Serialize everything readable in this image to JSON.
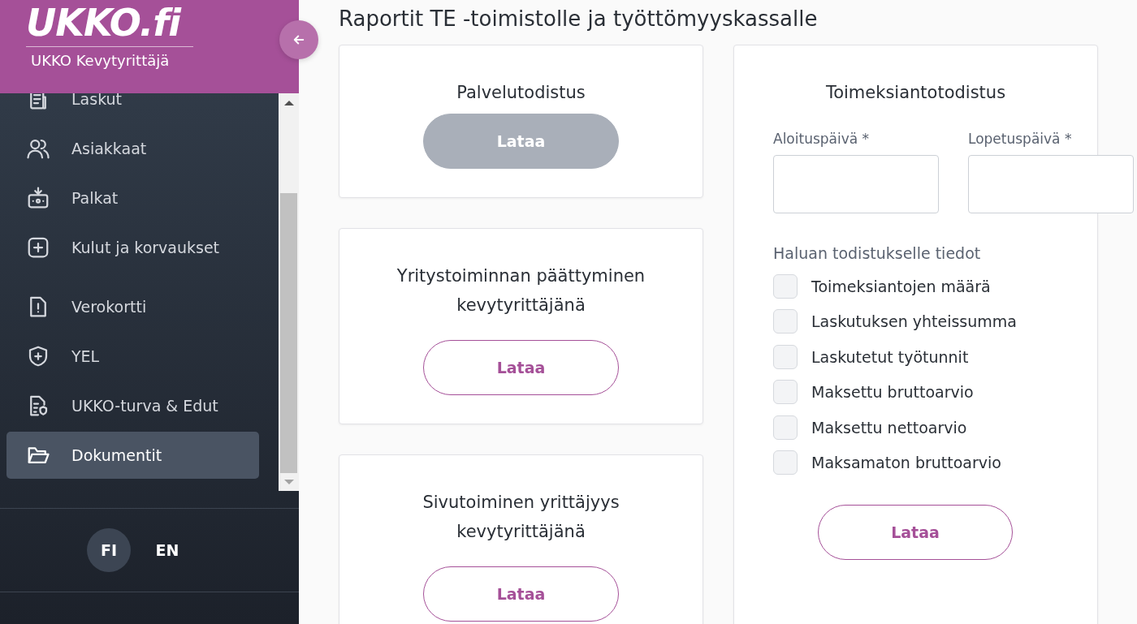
{
  "sidebar": {
    "logo": "UKKO.fi",
    "subtitle": "UKKO Kevytyrittäjä",
    "items": [
      {
        "label": "Laskut",
        "selected": false
      },
      {
        "label": "Asiakkaat",
        "selected": false
      },
      {
        "label": "Palkat",
        "selected": false
      },
      {
        "label": "Kulut ja korvaukset",
        "selected": false
      },
      {
        "label": "Verokortti",
        "selected": false
      },
      {
        "label": "YEL",
        "selected": false
      },
      {
        "label": "UKKO-turva & Edut",
        "selected": false
      },
      {
        "label": "Dokumentit",
        "selected": true
      }
    ],
    "languages": [
      {
        "label": "FI",
        "selected": true
      },
      {
        "label": "EN",
        "selected": false
      }
    ]
  },
  "main": {
    "title": "Raportit TE -toimistolle ja työttömyyskassalle",
    "cards": [
      {
        "title": "Palvelutodistus",
        "button": "Lataa",
        "disabled": true
      },
      {
        "title": "Yritystoiminnan päättyminen kevytyrittäjänä",
        "button": "Lataa",
        "disabled": false
      },
      {
        "title": "Sivutoiminen yrittäjyys kevytyrittäjänä",
        "button": "Lataa",
        "disabled": false
      }
    ],
    "assignment_card": {
      "title": "Toimeksiantotodistus",
      "fields": [
        {
          "label": "Aloituspäivä *"
        },
        {
          "label": "Lopetuspäivä *"
        }
      ],
      "options_label": "Haluan todistukselle tiedot",
      "options": [
        {
          "label": "Toimeksiantojen määrä",
          "checked": false
        },
        {
          "label": "Laskutuksen yhteissumma",
          "checked": false
        },
        {
          "label": "Laskutetut työtunnit",
          "checked": false
        },
        {
          "label": "Maksettu bruttoarvio",
          "checked": false
        },
        {
          "label": "Maksettu nettoarvio",
          "checked": false
        },
        {
          "label": "Maksamaton bruttoarvio",
          "checked": false
        }
      ],
      "button": "Lataa",
      "disabled": false
    }
  }
}
